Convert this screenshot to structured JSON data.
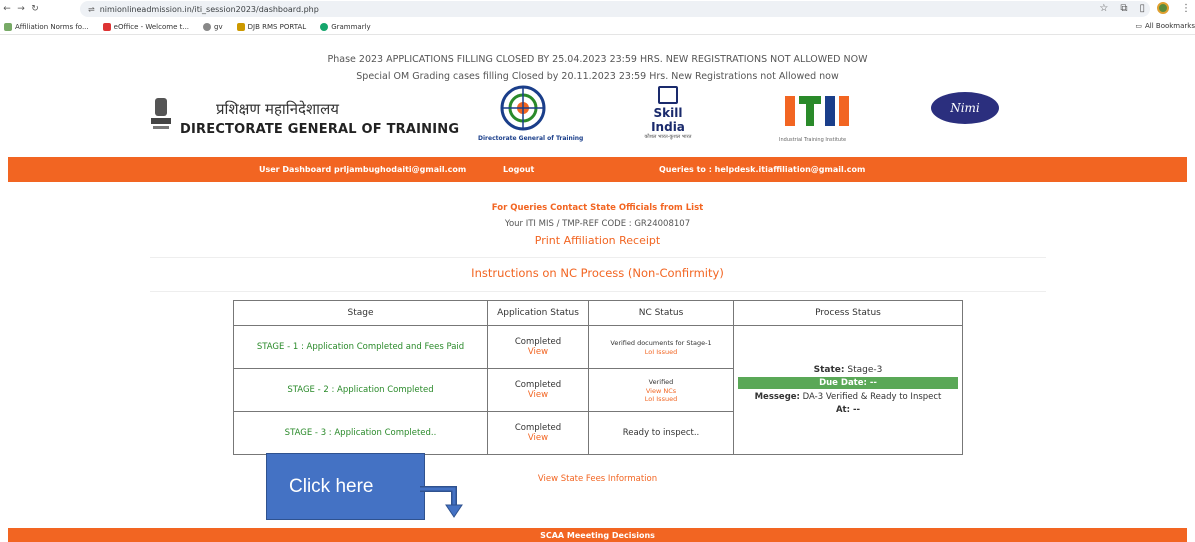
{
  "browser": {
    "url": "nimionlineadmission.in/iti_session2023/dashboard.php",
    "bookmarks": [
      "Affiliation Norms fo...",
      "eOffice - Welcome t...",
      "gv",
      "DJB RMS PORTAL",
      "Grammarly"
    ],
    "all_bookmarks": "All Bookmarks"
  },
  "header": {
    "notice1": "Phase 2023 APPLICATIONS FILLING CLOSED BY 25.04.2023 23:59 HRS. NEW REGISTRATIONS NOT ALLOWED NOW",
    "notice2": "Special OM Grading cases filling Closed by 20.11.2023 23:59 Hrs. New Registrations not Allowed now",
    "dgt_hindi": "प्रशिक्षण महानिदेशालय",
    "dgt_english": "DIRECTORATE GENERAL OF TRAINING",
    "dgt_logo_caption": "Directorate General of Training",
    "skill_india": "Skill India",
    "skill_india_sub": "कौशल भारत-कुशल भारत",
    "iti_caption": "Industrial Training Institute",
    "nimi": "Nimi"
  },
  "navbar": {
    "user": "User Dashboard prljambughodaiti@gmail.com",
    "logout": "Logout",
    "queries": "Queries to : helpdesk.itiaffiliation@gmail.com"
  },
  "main": {
    "queries_head": "For Queries Contact State Officials from List",
    "code_line": "Your ITI MIS / TMP-REF CODE : GR24008107",
    "receipt": "Print Affiliation Receipt",
    "instructions": "Instructions on NC Process (Non-Confirmity)",
    "fees_info": "View State Fees Information"
  },
  "table": {
    "headers": [
      "Stage",
      "Application Status",
      "NC Status",
      "Process Status"
    ],
    "rows": [
      {
        "stage": "STAGE - 1 : Application Completed and Fees Paid",
        "status": "Completed",
        "view": "View",
        "nc": "Verified documents for Stage-1",
        "nc_link": "LoI Issued"
      },
      {
        "stage": "STAGE - 2 : Application Completed",
        "status": "Completed",
        "view": "View",
        "nc": "Verified",
        "nc_link": "View NCs",
        "nc_link2": "LoI Issued"
      },
      {
        "stage": "STAGE - 3 : Application Completed..",
        "status": "Completed",
        "view": "View",
        "nc": "Ready to inspect.."
      }
    ],
    "process": {
      "state_label": "State:",
      "state_value": "Stage-3",
      "due": "Due Date: --",
      "message_label": "Messege:",
      "message_value": "DA-3 Verified & Ready to Inspect",
      "at": "At: --"
    }
  },
  "callout": "Click here",
  "footer_bar": "SCAA Meeeting Decisions",
  "colors": {
    "accent": "#f26522",
    "stage_green": "#2a8a2a",
    "due_bg": "#5aa857",
    "callout": "#4472c4"
  }
}
